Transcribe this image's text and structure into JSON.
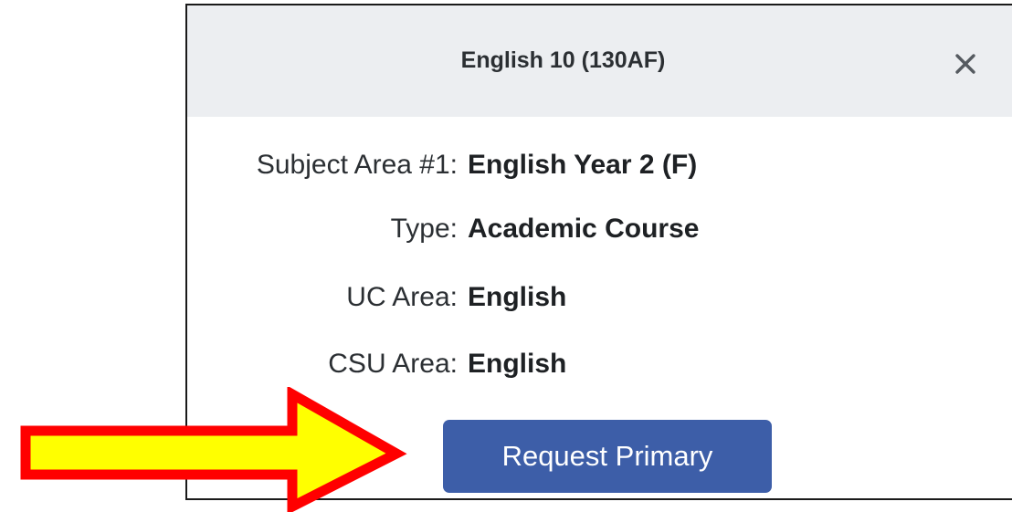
{
  "dialog": {
    "title": "English 10 (130AF)",
    "close_symbol": "close-icon"
  },
  "details": [
    {
      "label": "Subject Area #1:",
      "value": "English Year 2 (F)"
    },
    {
      "label": "Type:",
      "value": "Academic Course"
    },
    {
      "label": "UC Area:",
      "value": "English"
    },
    {
      "label": "CSU Area:",
      "value": "English"
    }
  ],
  "actions": {
    "request_primary_label": "Request Primary"
  },
  "annotation": {
    "arrow_fill": "#ffff00",
    "arrow_stroke": "#ff0000"
  },
  "colors": {
    "header_bg": "#eceef1",
    "primary_button": "#3d5ea8"
  }
}
